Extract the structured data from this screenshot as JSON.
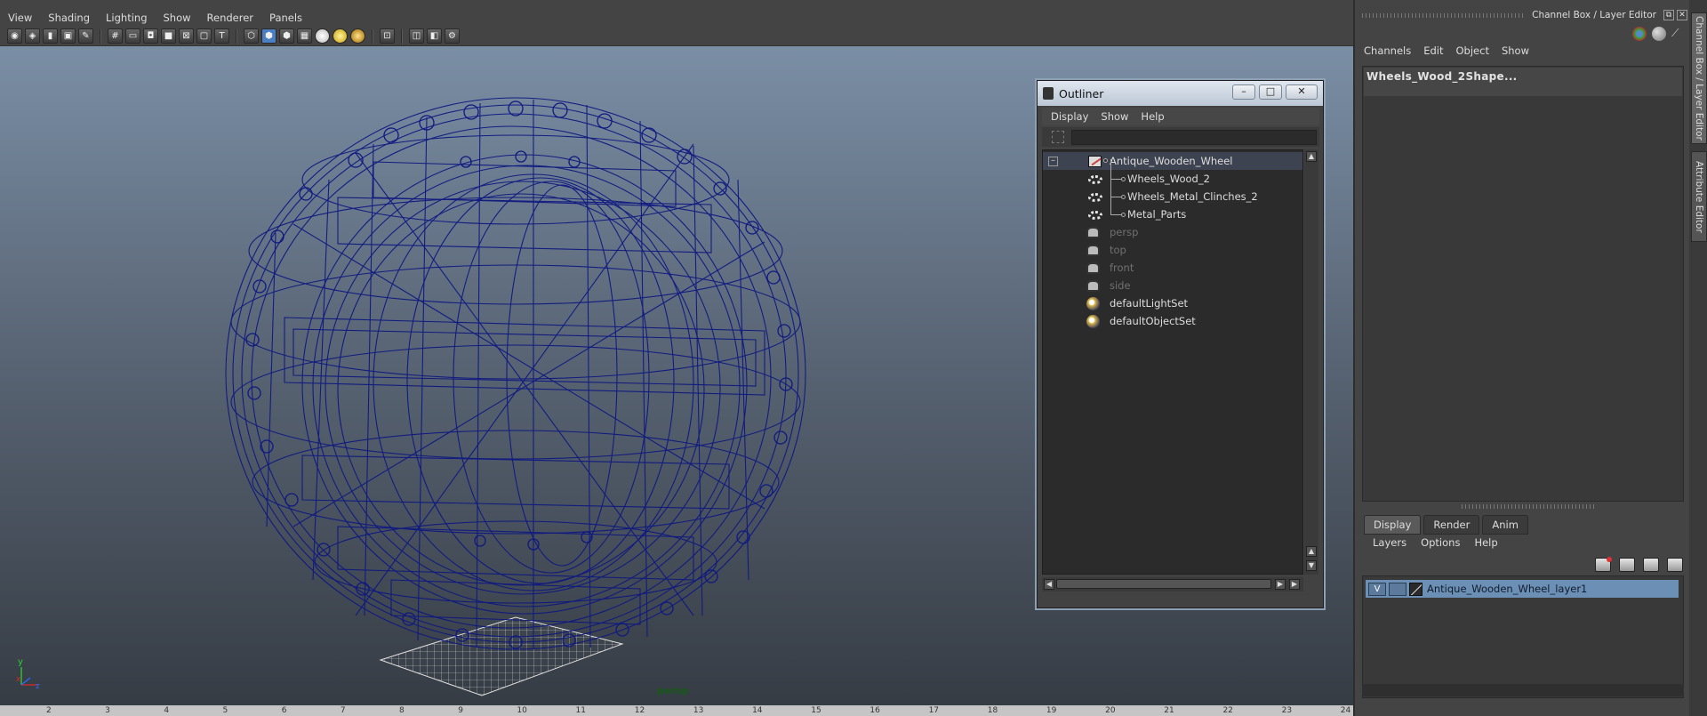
{
  "viewport": {
    "menus": [
      "View",
      "Shading",
      "Lighting",
      "Show",
      "Renderer",
      "Panels"
    ],
    "toolbar_icons": [
      "camera-icon",
      "camera-attr-icon",
      "bookmark-icon",
      "image-plane-icon",
      "2d-pan-icon",
      "grid-icon",
      "film-gate-icon",
      "resolution-gate-icon",
      "gate-mask-icon",
      "field-chart-icon",
      "safe-action-icon",
      "safe-title-icon",
      "wireframe-icon",
      "smooth-shade-icon",
      "wireframe-on-shaded-icon",
      "textured-icon",
      "default-light-icon",
      "use-all-lights-icon",
      "shadows-icon",
      "isolate-select-icon",
      "xray-icon",
      "xray-joints-icon",
      "hud-icon"
    ],
    "camera_label": "persp",
    "axis_labels": {
      "y": "y",
      "x": "x",
      "z": "z"
    },
    "timeline_ticks": [
      "2",
      "3",
      "4",
      "5",
      "6",
      "7",
      "8",
      "9",
      "10",
      "11",
      "12",
      "13",
      "14",
      "15",
      "16",
      "17",
      "18",
      "19",
      "20",
      "21",
      "22",
      "23",
      "24"
    ]
  },
  "outliner": {
    "title": "Outliner",
    "menus": [
      "Display",
      "Show",
      "Help"
    ],
    "rows": [
      {
        "label": "Antique_Wooden_Wheel",
        "icon": "transform-icon",
        "indent": 0,
        "selected": true,
        "dim": false,
        "expand": "–"
      },
      {
        "label": "Wheels_Wood_2",
        "icon": "mesh-group-icon",
        "indent": 1,
        "selected": false,
        "dim": false
      },
      {
        "label": "Wheels_Metal_Clinches_2",
        "icon": "mesh-group-icon",
        "indent": 1,
        "selected": false,
        "dim": false
      },
      {
        "label": "Metal_Parts",
        "icon": "mesh-group-icon",
        "indent": 1,
        "selected": false,
        "dim": false
      },
      {
        "label": "persp",
        "icon": "camera-icon",
        "indent": 0,
        "selected": false,
        "dim": true
      },
      {
        "label": "top",
        "icon": "camera-icon",
        "indent": 0,
        "selected": false,
        "dim": true
      },
      {
        "label": "front",
        "icon": "camera-icon",
        "indent": 0,
        "selected": false,
        "dim": true
      },
      {
        "label": "side",
        "icon": "camera-icon",
        "indent": 0,
        "selected": false,
        "dim": true
      },
      {
        "label": "defaultLightSet",
        "icon": "set-icon",
        "indent": 0,
        "selected": false,
        "dim": false
      },
      {
        "label": "defaultObjectSet",
        "icon": "set-icon",
        "indent": 0,
        "selected": false,
        "dim": false
      }
    ],
    "window_buttons": {
      "minimize": "–",
      "maximize": "□",
      "close": "✕"
    }
  },
  "channel_box": {
    "title": "Channel Box / Layer Editor",
    "menus": [
      "Channels",
      "Edit",
      "Object",
      "Show"
    ],
    "object_name": "Wheels_Wood_2Shape...",
    "side_tabs": [
      "Channel Box / Layer Editor",
      "Attribute Editor"
    ],
    "layer_tabs": [
      "Display",
      "Render",
      "Anim"
    ],
    "layer_menus": [
      "Layers",
      "Options",
      "Help"
    ],
    "layer": {
      "visibility": "V",
      "name": "Antique_Wooden_Wheel_layer1"
    }
  },
  "colors": {
    "wireframe": "#0f1880",
    "selection_highlight": "#6c8fb5",
    "camera_label": "#165a16"
  }
}
